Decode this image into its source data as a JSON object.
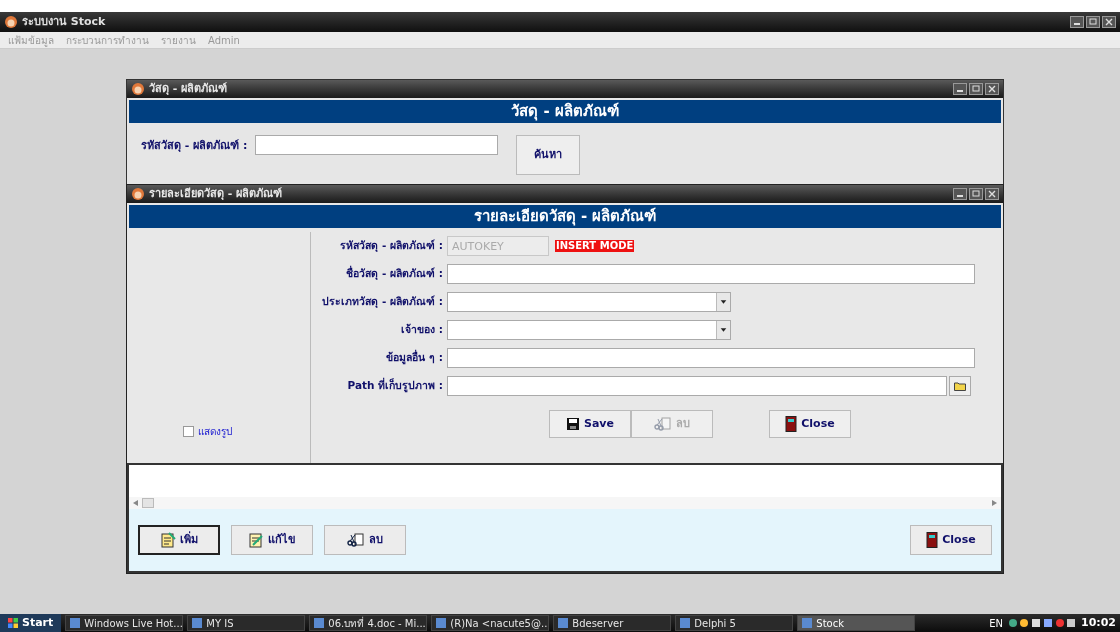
{
  "app_window": {
    "title": "ระบบงาน Stock"
  },
  "menu": [
    "แฟ้มข้อมูล",
    "กระบวนการทำงาน",
    "รายงาน",
    "Admin"
  ],
  "back_window": {
    "title": "วัสดุ - ผลิตภัณฑ์",
    "header": "วัสดุ - ผลิตภัณฑ์",
    "code_label": "รหัสวัสดุ - ผลิตภัณฑ์ :",
    "search_button": "ค้นหา"
  },
  "front_window": {
    "title": "รายละเอียดวัสดุ - ผลิตภัณฑ์",
    "header": "รายละเอียดวัสดุ - ผลิตภัณฑ์",
    "show_picture": {
      "label": "แสดงรูป",
      "checked": false
    },
    "fields": [
      {
        "kind": "text",
        "label": "รหัสวัสดุ - ผลิตภัณฑ์ :",
        "value": "AUTOKEY",
        "disabled": true,
        "badge": "INSERT MODE"
      },
      {
        "kind": "text",
        "label": "ชื่อวัสดุ - ผลิตภัณฑ์ :",
        "disabled": false
      },
      {
        "kind": "combo",
        "label": "ประเภทวัสดุ - ผลิตภัณฑ์ :",
        "disabled": false
      },
      {
        "kind": "combo",
        "label": "เจ้าของ :",
        "disabled": false
      },
      {
        "kind": "text",
        "label": "ข้อมูลอื่น ๆ :",
        "disabled": false
      },
      {
        "kind": "path",
        "label": "Path ที่เก็บรูปภาพ :",
        "disabled": false
      }
    ],
    "form_buttons": [
      {
        "kind": "save",
        "label": "Save",
        "disabled": false
      },
      {
        "kind": "delete",
        "label": "ลบ",
        "disabled": true
      },
      {
        "kind": "close",
        "label": "Close",
        "disabled": false
      }
    ],
    "bottom_buttons": [
      {
        "kind": "add",
        "label": "เพิ่ม",
        "selected": true
      },
      {
        "kind": "edit",
        "label": "แก้ไข",
        "selected": false
      },
      {
        "kind": "delete",
        "label": "ลบ",
        "selected": false
      },
      {
        "kind": "close",
        "label": "Close",
        "selected": false
      }
    ]
  },
  "taskbar": {
    "start": "Start",
    "items": [
      {
        "label": "Windows Live Hot...",
        "selected": false
      },
      {
        "label": "MY IS",
        "selected": false
      },
      {
        "label": "06.บทที่ 4.doc - Mi...",
        "selected": false
      },
      {
        "label": "(R)Na <nacute5@...",
        "selected": false
      },
      {
        "label": "Bdeserver",
        "selected": false
      },
      {
        "label": "Delphi 5",
        "selected": false
      },
      {
        "label": "Stock",
        "selected": true
      }
    ],
    "language": "EN",
    "clock": "10:02"
  }
}
